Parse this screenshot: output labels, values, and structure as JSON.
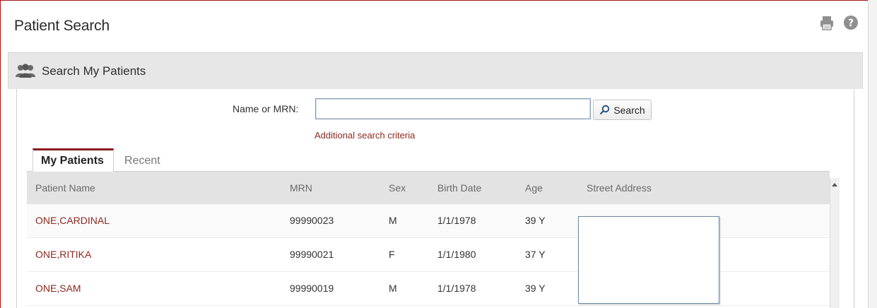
{
  "header": {
    "title": "Patient Search",
    "icons": [
      "print-icon",
      "help-icon"
    ]
  },
  "section": {
    "title": "Search My Patients",
    "icon": "group-icon"
  },
  "search": {
    "label": "Name or MRN:",
    "value": "",
    "placeholder": "",
    "button_label": "Search",
    "additional_link": "Additional search criteria"
  },
  "tabs": [
    {
      "label": "My Patients",
      "active": true
    },
    {
      "label": "Recent",
      "active": false
    }
  ],
  "table": {
    "columns": [
      "Patient Name",
      "MRN",
      "Sex",
      "Birth Date",
      "Age",
      "Street Address"
    ],
    "rows": [
      {
        "name": "ONE,CARDINAL",
        "mrn": "99990023",
        "sex": "M",
        "birth_date": "1/1/1978",
        "age": "39 Y",
        "street_address": ""
      },
      {
        "name": "ONE,RITIKA",
        "mrn": "99990021",
        "sex": "F",
        "birth_date": "1/1/1980",
        "age": "37 Y",
        "street_address": ""
      },
      {
        "name": "ONE,SAM",
        "mrn": "99990019",
        "sex": "M",
        "birth_date": "1/1/1978",
        "age": "39 Y",
        "street_address": ""
      }
    ]
  },
  "colors": {
    "accent": "#8a1c1c",
    "link": "#8a2a22",
    "header_bg": "#e7e7e7"
  }
}
